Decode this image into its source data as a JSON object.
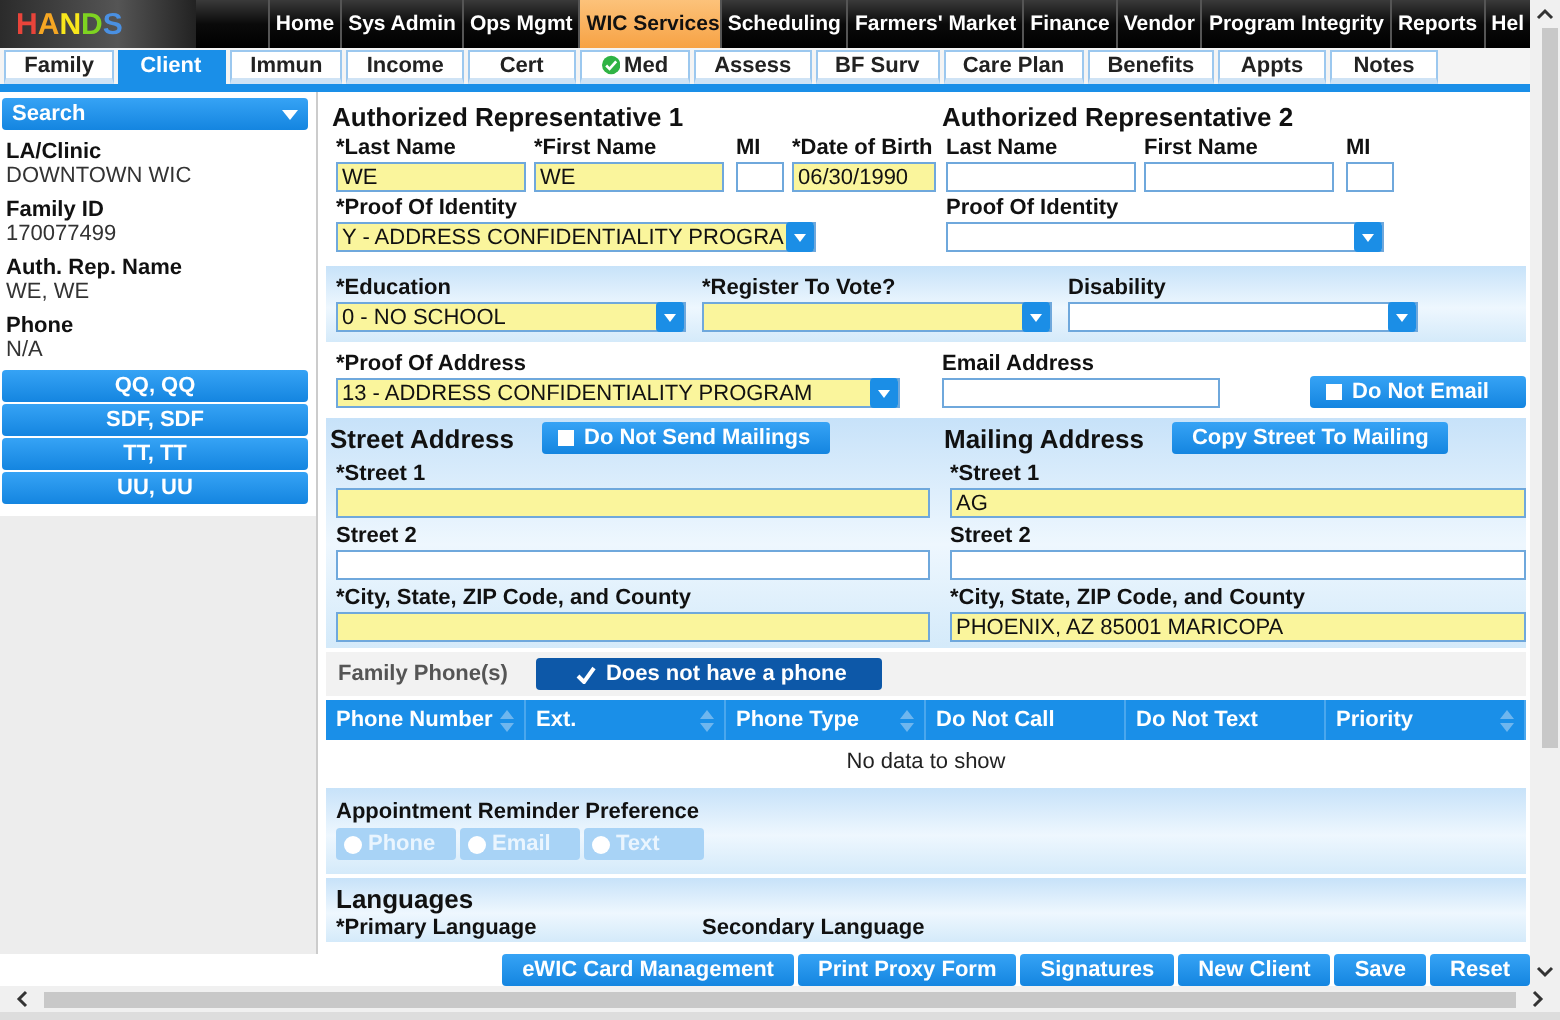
{
  "logo": {
    "text": "HANDS"
  },
  "nav": [
    {
      "label": "Home",
      "selected": false
    },
    {
      "label": "Sys Admin",
      "selected": false
    },
    {
      "label": "Ops Mgmt",
      "selected": false
    },
    {
      "label": "WIC Services",
      "selected": true
    },
    {
      "label": "Scheduling",
      "selected": false
    },
    {
      "label": "Farmers' Market",
      "selected": false
    },
    {
      "label": "Finance",
      "selected": false
    },
    {
      "label": "Vendor",
      "selected": false
    },
    {
      "label": "Program Integrity",
      "selected": false
    },
    {
      "label": "Reports",
      "selected": false
    },
    {
      "label": "Hel",
      "selected": false
    }
  ],
  "tabs": [
    {
      "label": "Family",
      "selected": false,
      "checked": false
    },
    {
      "label": "Client",
      "selected": true,
      "checked": false
    },
    {
      "label": "Immun",
      "selected": false,
      "checked": false
    },
    {
      "label": "Income",
      "selected": false,
      "checked": false
    },
    {
      "label": "Cert",
      "selected": false,
      "checked": false
    },
    {
      "label": "Med",
      "selected": false,
      "checked": true
    },
    {
      "label": "Assess",
      "selected": false,
      "checked": false
    },
    {
      "label": "BF Surv",
      "selected": false,
      "checked": false
    },
    {
      "label": "Care Plan",
      "selected": false,
      "checked": false
    },
    {
      "label": "Benefits",
      "selected": false,
      "checked": false
    },
    {
      "label": "Appts",
      "selected": false,
      "checked": false
    },
    {
      "label": "Notes",
      "selected": false,
      "checked": false
    }
  ],
  "sidebar": {
    "search": "Search",
    "details": [
      {
        "label": "LA/Clinic",
        "value": "DOWNTOWN WIC"
      },
      {
        "label": "Family ID",
        "value": "170077499"
      },
      {
        "label": "Auth. Rep. Name",
        "value": "WE, WE"
      },
      {
        "label": "Phone",
        "value": "N/A"
      }
    ],
    "members": [
      "QQ, QQ",
      "SDF, SDF",
      "TT, TT",
      "UU, UU"
    ]
  },
  "rep1": {
    "title": "Authorized Representative 1",
    "fields": [
      {
        "label": "*Last Name",
        "value": "WE",
        "required": true,
        "kind": "text"
      },
      {
        "label": "*First Name",
        "value": "WE",
        "required": true,
        "kind": "text"
      },
      {
        "label": "MI",
        "required": false,
        "kind": "text"
      },
      {
        "label": "*Date of Birth",
        "value": "06/30/1990",
        "required": true,
        "kind": "text"
      }
    ],
    "proof": {
      "label": "*Proof Of Identity",
      "value": "Y - ADDRESS CONFIDENTIALITY PROGRA",
      "required": true,
      "kind": "select"
    }
  },
  "rep2": {
    "title": "Authorized Representative 2",
    "fields": [
      {
        "label": "Last Name",
        "required": false,
        "kind": "text"
      },
      {
        "label": "First Name",
        "required": false,
        "kind": "text"
      },
      {
        "label": "MI",
        "required": false,
        "kind": "text"
      }
    ],
    "proof": {
      "label": "Proof Of Identity",
      "required": false,
      "kind": "select"
    }
  },
  "demographics": [
    {
      "label": "*Education",
      "value": "0 - NO SCHOOL",
      "required": true,
      "kind": "select"
    },
    {
      "label": "*Register To Vote?",
      "required": true,
      "kind": "select"
    },
    {
      "label": "Disability",
      "required": false,
      "kind": "select"
    }
  ],
  "proof_of_address": {
    "label": "*Proof Of Address",
    "value": "13 - ADDRESS CONFIDENTIALITY PROGRAM",
    "required": true,
    "kind": "select"
  },
  "email": {
    "label": "Email Address",
    "required": false,
    "kind": "text"
  },
  "do_not_email": {
    "label": "Do Not Email",
    "checked": false
  },
  "street_address": {
    "title": "Street Address",
    "toggle": {
      "label": "Do Not Send Mailings",
      "checked": false
    },
    "fields": [
      {
        "label": "*Street 1",
        "required": true,
        "kind": "text"
      },
      {
        "label": "Street 2",
        "required": false,
        "kind": "text"
      },
      {
        "label": "*City, State, ZIP Code, and County",
        "required": true,
        "kind": "text"
      }
    ]
  },
  "mailing_address": {
    "title": "Mailing Address",
    "button": "Copy Street To Mailing",
    "fields": [
      {
        "label": "*Street 1",
        "value": "AG",
        "required": true,
        "kind": "text"
      },
      {
        "label": "Street 2",
        "required": false,
        "kind": "text"
      },
      {
        "label": "*City, State, ZIP Code, and County",
        "value": "PHOENIX, AZ 85001 MARICOPA",
        "required": true,
        "kind": "text"
      }
    ]
  },
  "family_phones": {
    "label": "Family Phone(s)",
    "toggle": {
      "label": "Does not have a phone",
      "checked": true
    },
    "columns": [
      {
        "label": "Phone Number",
        "sortable": true
      },
      {
        "label": "Ext.",
        "sortable": true
      },
      {
        "label": "Phone Type",
        "sortable": true
      },
      {
        "label": "Do Not Call",
        "sortable": false
      },
      {
        "label": "Do Not Text",
        "sortable": false
      },
      {
        "label": "Priority",
        "sortable": true
      }
    ],
    "empty": "No data to show"
  },
  "appointment_reminder": {
    "label": "Appointment Reminder Preference",
    "options": [
      {
        "label": "Phone",
        "selected": false,
        "disabled": true
      },
      {
        "label": "Email",
        "selected": false,
        "disabled": true
      },
      {
        "label": "Text",
        "selected": false,
        "disabled": true
      }
    ]
  },
  "languages": {
    "title": "Languages",
    "labels": [
      "*Primary Language",
      "Secondary Language"
    ]
  },
  "actions": [
    "eWIC Card Management",
    "Print Proxy Form",
    "Signatures",
    "New Client",
    "Save",
    "Reset"
  ]
}
